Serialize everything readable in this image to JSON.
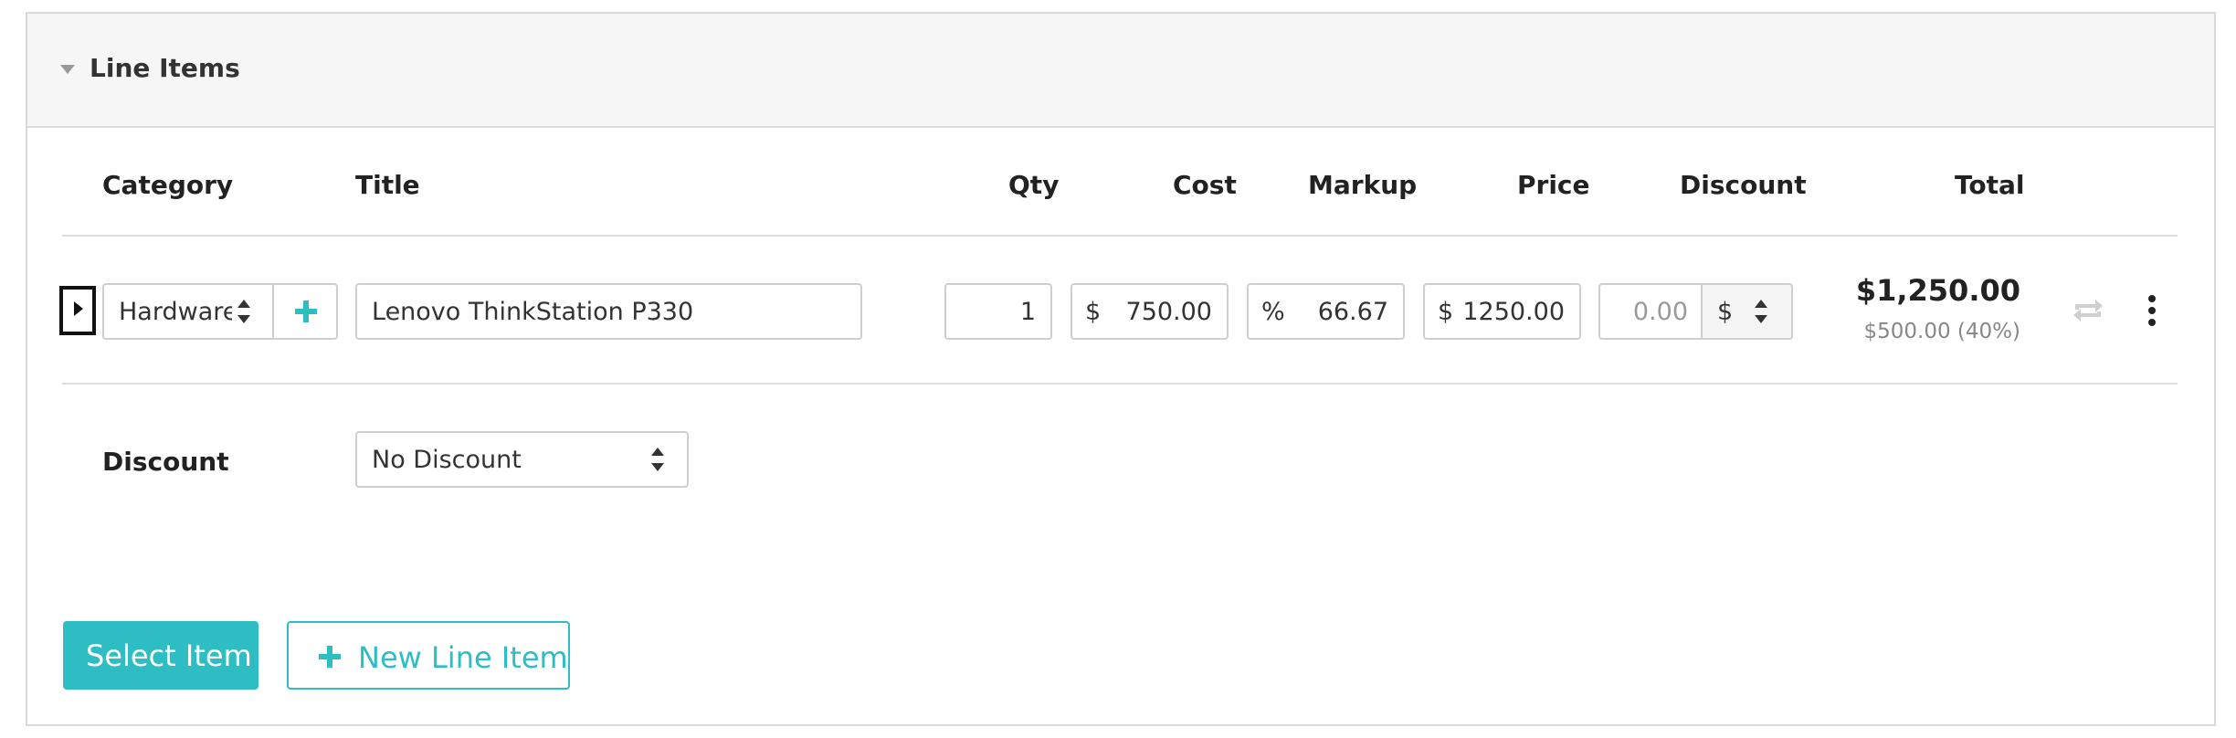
{
  "panel": {
    "title": "Line Items"
  },
  "table": {
    "headers": {
      "category": "Category",
      "title": "Title",
      "qty": "Qty",
      "cost": "Cost",
      "markup": "Markup",
      "price": "Price",
      "discount": "Discount",
      "total": "Total"
    },
    "row": {
      "category": "Hardware",
      "title": "Lenovo ThinkStation P330",
      "qty": "1",
      "cost_symbol": "$",
      "cost": "750.00",
      "markup_symbol": "%",
      "markup": "66.67",
      "price_symbol": "$",
      "price": "1250.00",
      "discount_value": "0.00",
      "discount_type": "$",
      "total": "$1,250.00",
      "profit": "$500.00 (40%)"
    }
  },
  "discount_section": {
    "label": "Discount",
    "selected": "No Discount"
  },
  "actions": {
    "select_item": "Select Item",
    "new_line_item": "New Line Item"
  },
  "colors": {
    "accent": "#2fbdc4",
    "header_bg": "#f6f6f6"
  },
  "icons": {
    "collapse": "caret-down-icon",
    "expand": "caret-right-icon",
    "add_category": "plus-icon",
    "sync": "repeat-icon",
    "menu": "kebab-icon"
  }
}
